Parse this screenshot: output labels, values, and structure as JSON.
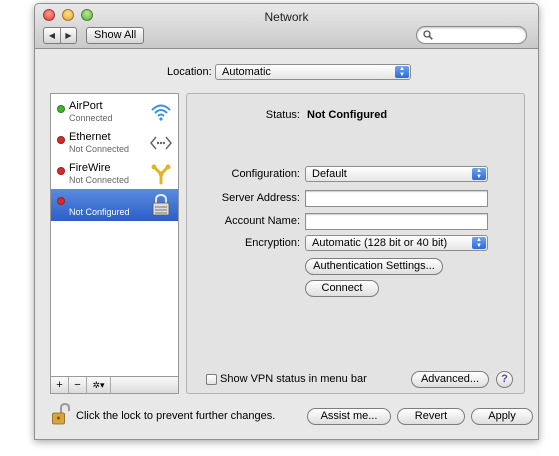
{
  "window": {
    "title": "Network"
  },
  "toolbar": {
    "back_glyph": "◀",
    "forward_glyph": "▶",
    "show_all_label": "Show All",
    "search_placeholder": ""
  },
  "location": {
    "label": "Location:",
    "value": "Automatic"
  },
  "services": [
    {
      "name": "AirPort",
      "status": "Connected",
      "status_color": "#3fb72b",
      "icon": "wifi-icon"
    },
    {
      "name": "Ethernet",
      "status": "Not Connected",
      "status_color": "#d92b2b",
      "icon": "ethernet-icon"
    },
    {
      "name": "FireWire",
      "status": "Not Connected",
      "status_color": "#d92b2b",
      "icon": "firewire-icon"
    },
    {
      "name": "",
      "status": "Not Configured",
      "status_color": "#d92b2b",
      "icon": "vpn-lock-icon",
      "selected": true
    }
  ],
  "list_toolbar": {
    "add": "+",
    "remove": "−",
    "action": "✲▾"
  },
  "detail": {
    "status_label": "Status:",
    "status_value": "Not Configured",
    "configuration_label": "Configuration:",
    "configuration_value": "Default",
    "server_address_label": "Server Address:",
    "server_address_value": "",
    "account_name_label": "Account Name:",
    "account_name_value": "",
    "encryption_label": "Encryption:",
    "encryption_value": "Automatic (128 bit or 40 bit)",
    "auth_settings_label": "Authentication Settings...",
    "connect_label": "Connect",
    "show_vpn_label": "Show VPN status in menu bar",
    "show_vpn_checked": false,
    "advanced_label": "Advanced...",
    "help_glyph": "?"
  },
  "footer": {
    "lock_text": "Click the lock to prevent further changes.",
    "assist_label": "Assist me...",
    "revert_label": "Revert",
    "apply_label": "Apply"
  },
  "colors": {
    "selection": "#3a6fd6",
    "connected": "#3fb72b",
    "disconnected": "#d92b2b"
  }
}
